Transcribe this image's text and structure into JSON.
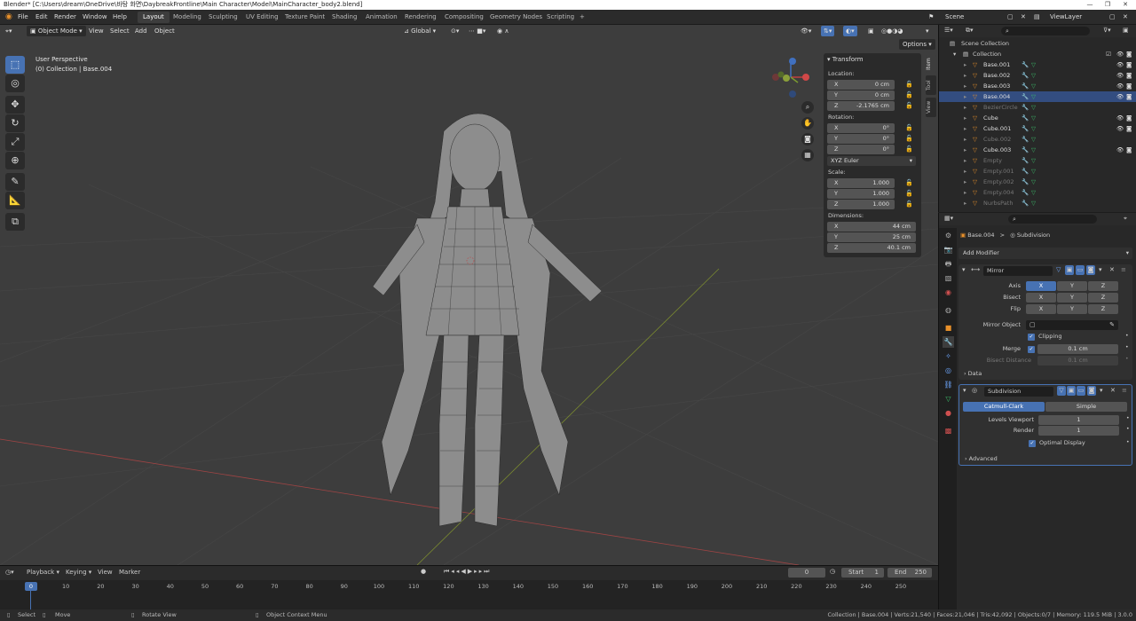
{
  "titlebar": {
    "title": "Blender* [C:\\Users\\dream\\OneDrive\\바탕 화면\\DaybreakFrontline\\Main Character\\Model\\MainCharacter_body2.blend]"
  },
  "menus": [
    "File",
    "Edit",
    "Render",
    "Window",
    "Help"
  ],
  "workspaces": [
    "Layout",
    "Modeling",
    "Sculpting",
    "UV Editing",
    "Texture Paint",
    "Shading",
    "Animation",
    "Rendering",
    "Compositing",
    "Geometry Nodes",
    "Scripting",
    "+"
  ],
  "scene": {
    "label": "Scene",
    "viewlayer": "ViewLayer"
  },
  "viewport_header": {
    "mode": "Object Mode",
    "view": "View",
    "select": "Select",
    "add": "Add",
    "object": "Object",
    "orientation": "Global",
    "options": "Options"
  },
  "viewport": {
    "perspective": "User Perspective",
    "collection": "(0) Collection | Base.004"
  },
  "npanel": {
    "section": "Transform",
    "location_label": "Location:",
    "location": [
      {
        "ax": "X",
        "v": "0 cm"
      },
      {
        "ax": "Y",
        "v": "0 cm"
      },
      {
        "ax": "Z",
        "v": "-2.1765 cm"
      }
    ],
    "rotation_label": "Rotation:",
    "rotation": [
      {
        "ax": "X",
        "v": "0°"
      },
      {
        "ax": "Y",
        "v": "0°"
      },
      {
        "ax": "Z",
        "v": "0°"
      }
    ],
    "rotation_mode": "XYZ Euler",
    "scale_label": "Scale:",
    "scale": [
      {
        "ax": "X",
        "v": "1.000"
      },
      {
        "ax": "Y",
        "v": "1.000"
      },
      {
        "ax": "Z",
        "v": "1.000"
      }
    ],
    "dimensions_label": "Dimensions:",
    "dimensions": [
      {
        "ax": "X",
        "v": "44 cm"
      },
      {
        "ax": "Y",
        "v": "25 cm"
      },
      {
        "ax": "Z",
        "v": "40.1 cm"
      }
    ],
    "tabs": [
      "Item",
      "Tool",
      "View"
    ]
  },
  "outliner": {
    "root": "Scene Collection",
    "collection": "Collection",
    "items": [
      {
        "name": "Base.001",
        "dim": false
      },
      {
        "name": "Base.002",
        "dim": false
      },
      {
        "name": "Base.003",
        "dim": false
      },
      {
        "name": "Base.004",
        "dim": false,
        "selected": true
      },
      {
        "name": "BezierCircle",
        "dim": true
      },
      {
        "name": "Cube",
        "dim": false
      },
      {
        "name": "Cube.001",
        "dim": false
      },
      {
        "name": "Cube.002",
        "dim": true
      },
      {
        "name": "Cube.003",
        "dim": false
      },
      {
        "name": "Empty",
        "dim": true
      },
      {
        "name": "Empty.001",
        "dim": true
      },
      {
        "name": "Empty.002",
        "dim": true
      },
      {
        "name": "Empty.004",
        "dim": true
      },
      {
        "name": "NurbsPath",
        "dim": true
      }
    ]
  },
  "properties": {
    "breadcrumb_object": "Base.004",
    "breadcrumb_sep": ">",
    "breadcrumb_modifier": "Subdivision",
    "add_modifier": "Add Modifier",
    "mirror": {
      "name": "Mirror",
      "axis_label": "Axis",
      "bisect_label": "Bisect",
      "flip_label": "Flip",
      "xyz": [
        "X",
        "Y",
        "Z"
      ],
      "mirror_object_label": "Mirror Object",
      "clipping_label": "Clipping",
      "merge_label": "Merge",
      "merge_value": "0.1 cm",
      "bisect_distance_label": "Bisect Distance",
      "bisect_distance_value": "0.1 cm",
      "data_label": "Data"
    },
    "subdivision": {
      "name": "Subdivision",
      "catmull": "Catmull-Clark",
      "simple": "Simple",
      "levels_viewport_label": "Levels Viewport",
      "levels_viewport": "1",
      "render_label": "Render",
      "render": "1",
      "optimal_display": "Optimal Display",
      "advanced": "Advanced"
    }
  },
  "timeline": {
    "playback": "Playback",
    "keying": "Keying",
    "view": "View",
    "marker": "Marker",
    "current_frame": "0",
    "start_label": "Start",
    "start": "1",
    "end_label": "End",
    "end": "250",
    "ticks": [
      "0",
      "10",
      "20",
      "30",
      "40",
      "50",
      "60",
      "70",
      "80",
      "90",
      "100",
      "110",
      "120",
      "130",
      "140",
      "150",
      "160",
      "170",
      "180",
      "190",
      "200",
      "210",
      "220",
      "230",
      "240",
      "250"
    ]
  },
  "statusbar": {
    "select": "Select",
    "move": "Move",
    "rotate": "Rotate View",
    "context": "Object Context Menu",
    "stats": "Collection | Base.004 | Verts:21,540 | Faces:21,046 | Tris:42,092 | Objects:0/7 | Memory: 119.5 MiB | 3.0.0"
  },
  "colors": {
    "accent": "#4772b3",
    "viewport_bg": "#3d3d3d",
    "panel_bg": "#282828",
    "orange_icon": "#e8902a",
    "green_icon": "#3cbf6b"
  }
}
